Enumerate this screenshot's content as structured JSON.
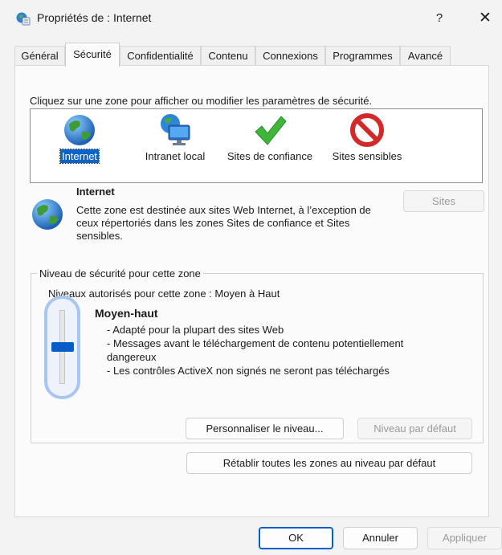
{
  "window": {
    "title": "Propriétés de : Internet",
    "help": "?",
    "close": "✕"
  },
  "tabs": [
    {
      "label": "Général"
    },
    {
      "label": "Sécurité",
      "active": true
    },
    {
      "label": "Confidentialité"
    },
    {
      "label": "Contenu"
    },
    {
      "label": "Connexions"
    },
    {
      "label": "Programmes"
    },
    {
      "label": "Avancé"
    }
  ],
  "zones": {
    "instruction": "Cliquez sur une zone pour afficher ou modifier les paramètres de sécurité.",
    "items": [
      {
        "label": "Internet",
        "icon": "globe-icon",
        "selected": true
      },
      {
        "label": "Intranet local",
        "icon": "intranet-icon"
      },
      {
        "label": "Sites de confiance",
        "icon": "checkmark-icon"
      },
      {
        "label": "Sites sensibles",
        "icon": "prohibited-icon"
      }
    ]
  },
  "selected_zone": {
    "name": "Internet",
    "description": "Cette zone est destinée aux sites Web Internet, à l’exception de ceux répertoriés dans les zones Sites de confiance et Sites sensibles.",
    "sites_button": "Sites"
  },
  "security_level": {
    "group_label": "Niveau de sécurité pour cette zone",
    "allowed_levels": "Niveaux autorisés pour cette zone : Moyen à Haut",
    "level_name": "Moyen-haut",
    "details": [
      "- Adapté pour la plupart des sites Web",
      "- Messages avant le téléchargement de contenu potentiellement",
      "dangereux",
      "- Les contrôles ActiveX non signés ne seront pas téléchargés"
    ],
    "slider_level": 0.5,
    "customize_button": "Personnaliser le niveau...",
    "default_level_button": "Niveau par défaut"
  },
  "reset_all_button": "Rétablir toutes les zones au niveau par défaut",
  "footer": {
    "ok": "OK",
    "cancel": "Annuler",
    "apply": "Appliquer"
  },
  "colors": {
    "accent": "#0a5cc8",
    "slider_focus": "#a9c6f2",
    "selection": "#0a64c8"
  }
}
